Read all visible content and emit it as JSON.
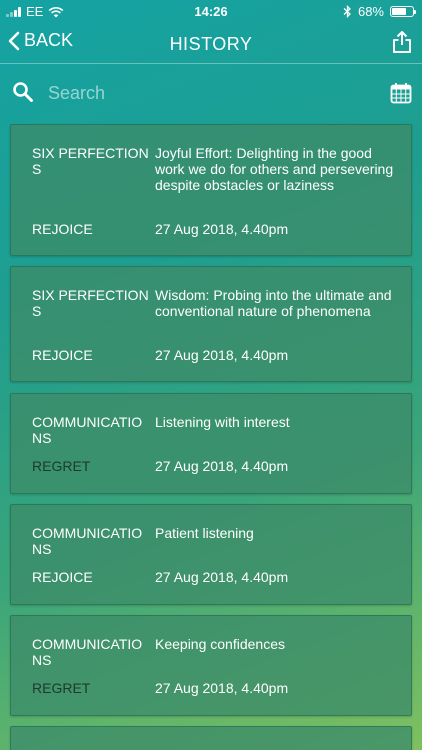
{
  "status_bar": {
    "carrier": "EE",
    "time": "14:26",
    "battery_percent": "68%",
    "battery_level": 0.68
  },
  "nav": {
    "back_label": "BACK",
    "title": "HISTORY"
  },
  "search": {
    "placeholder": "Search",
    "value": ""
  },
  "entries": [
    {
      "category": "SIX PERFECTIONS",
      "description": "Joyful Effort: Delighting in the good work we do for others and persevering despite obstacles or laziness",
      "action": "REJOICE",
      "timestamp": "27 Aug 2018, 4.40pm"
    },
    {
      "category": "SIX PERFECTIONS",
      "description": "Wisdom: Probing into the ultimate and conventional nature of phenomena",
      "action": "REJOICE",
      "timestamp": "27 Aug 2018, 4.40pm"
    },
    {
      "category": "COMMUNICATIONS",
      "description": "Listening with interest",
      "action": "REGRET",
      "timestamp": "27 Aug 2018, 4.40pm"
    },
    {
      "category": "COMMUNICATIONS",
      "description": "Patient listening",
      "action": "REJOICE",
      "timestamp": "27 Aug 2018, 4.40pm"
    },
    {
      "category": "COMMUNICATIONS",
      "description": "Keeping confidences",
      "action": "REGRET",
      "timestamp": "27 Aug 2018, 4.40pm"
    }
  ],
  "colors": {
    "regret_text": "#1d3a2c",
    "rejoice_text": "#ffffff"
  }
}
